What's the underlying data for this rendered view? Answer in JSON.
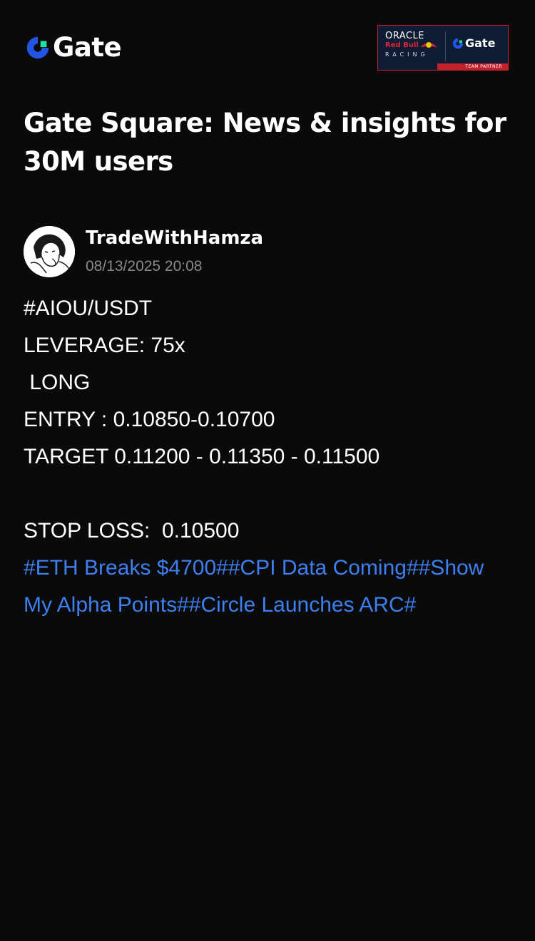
{
  "header": {
    "logo_text": "Gate",
    "partner_badge": {
      "oracle": "ORACLE",
      "redbull": "Red Bull",
      "racing": "RACING",
      "gate": "Gate",
      "team_partner": "TEAM PARTNER"
    }
  },
  "page_title": "Gate Square: News & insights for 30M users",
  "post": {
    "author": "TradeWithHamza",
    "timestamp": "08/13/2025 20:08",
    "lines": [
      "#AIOU/USDT",
      "LEVERAGE: 75x",
      " LONG",
      "ENTRY : 0.10850-0.10700",
      "TARGET 0.11200 - 0.11350 - 0.11500",
      "",
      "STOP LOSS:  0.10500"
    ],
    "hashtags": "#ETH Breaks $4700##CPI Data Coming##Show My Alpha Points##Circle Launches ARC#"
  },
  "colors": {
    "background": "#0a0a0a",
    "hashtag": "#3d7ff0",
    "brand_blue": "#2354e6",
    "brand_green": "#17e6a1",
    "muted_text": "#8a8a8a"
  }
}
